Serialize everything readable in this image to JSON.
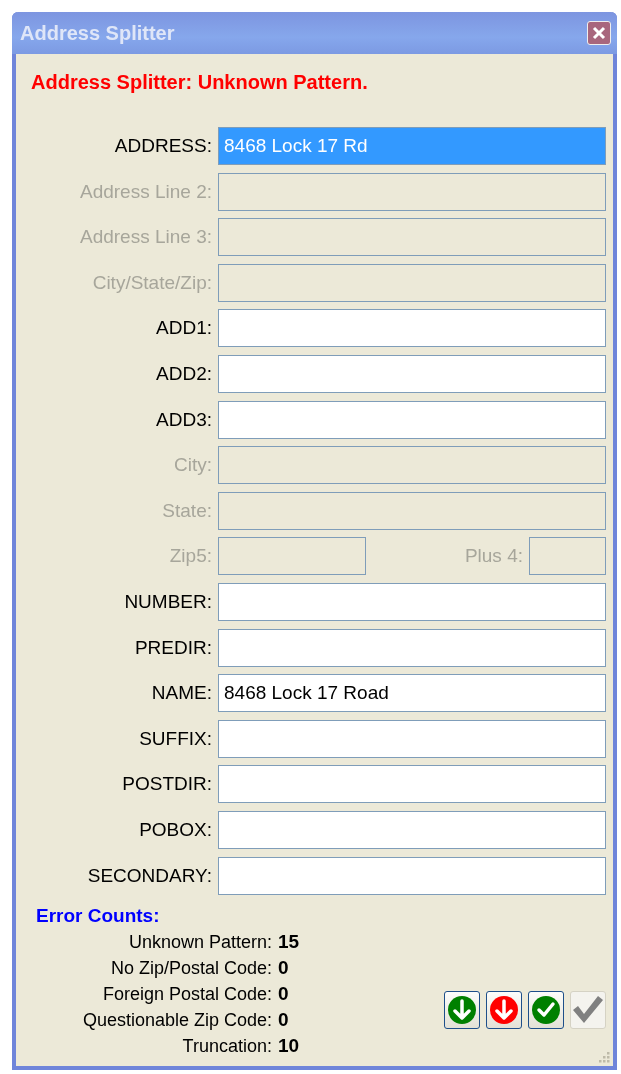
{
  "window": {
    "title": "Address Splitter"
  },
  "status_message": "Address Splitter: Unknown Pattern.",
  "fields": [
    {
      "kind": "single",
      "label": "ADDRESS:",
      "value": "8468 Lock 17 Rd",
      "disabled": false,
      "selected": true
    },
    {
      "kind": "single",
      "label": "Address Line 2:",
      "disabled": true,
      "selected": false
    },
    {
      "kind": "single",
      "label": "Address Line 3:",
      "disabled": true,
      "selected": false
    },
    {
      "kind": "single",
      "label": "City/State/Zip:",
      "disabled": true,
      "selected": false
    },
    {
      "kind": "single",
      "label": "ADD1:",
      "disabled": false,
      "selected": false
    },
    {
      "kind": "single",
      "label": "ADD2:",
      "disabled": false,
      "selected": false
    },
    {
      "kind": "single",
      "label": "ADD3:",
      "disabled": false,
      "selected": false
    },
    {
      "kind": "single",
      "label": "City:",
      "disabled": true,
      "selected": false
    },
    {
      "kind": "single",
      "label": "State:",
      "disabled": true,
      "selected": false
    },
    {
      "kind": "pair",
      "label": "Zip5:",
      "second_label": "Plus 4:",
      "disabled": true,
      "selected": false
    },
    {
      "kind": "single",
      "label": "NUMBER:",
      "disabled": false,
      "selected": false
    },
    {
      "kind": "single",
      "label": "PREDIR:",
      "disabled": false,
      "selected": false
    },
    {
      "kind": "single",
      "label": "NAME:",
      "value": "8468 Lock 17 Road",
      "disabled": false,
      "selected": false
    },
    {
      "kind": "single",
      "label": "SUFFIX:",
      "disabled": false,
      "selected": false
    },
    {
      "kind": "single",
      "label": "POSTDIR:",
      "disabled": false,
      "selected": false
    },
    {
      "kind": "single",
      "label": "POBOX:",
      "disabled": false,
      "selected": false
    },
    {
      "kind": "single",
      "label": "SECONDARY:",
      "disabled": false,
      "selected": false
    }
  ],
  "error_counts": {
    "title": "Error Counts:",
    "rows": [
      {
        "label": "Unknown Pattern:",
        "value": "15"
      },
      {
        "label": "No Zip/Postal Code:",
        "value": "0"
      },
      {
        "label": "Foreign Postal Code:",
        "value": "0"
      },
      {
        "label": "Questionable Zip Code:",
        "value": "0"
      },
      {
        "label": "Truncation:",
        "value": "10"
      }
    ]
  },
  "buttons": [
    {
      "kind": "down",
      "color": "#008000",
      "disabled": false
    },
    {
      "kind": "down",
      "color": "#ff0000",
      "disabled": false
    },
    {
      "kind": "check",
      "color": "#008000",
      "disabled": false
    },
    {
      "kind": "check",
      "color": "#808080",
      "disabled": true
    }
  ]
}
